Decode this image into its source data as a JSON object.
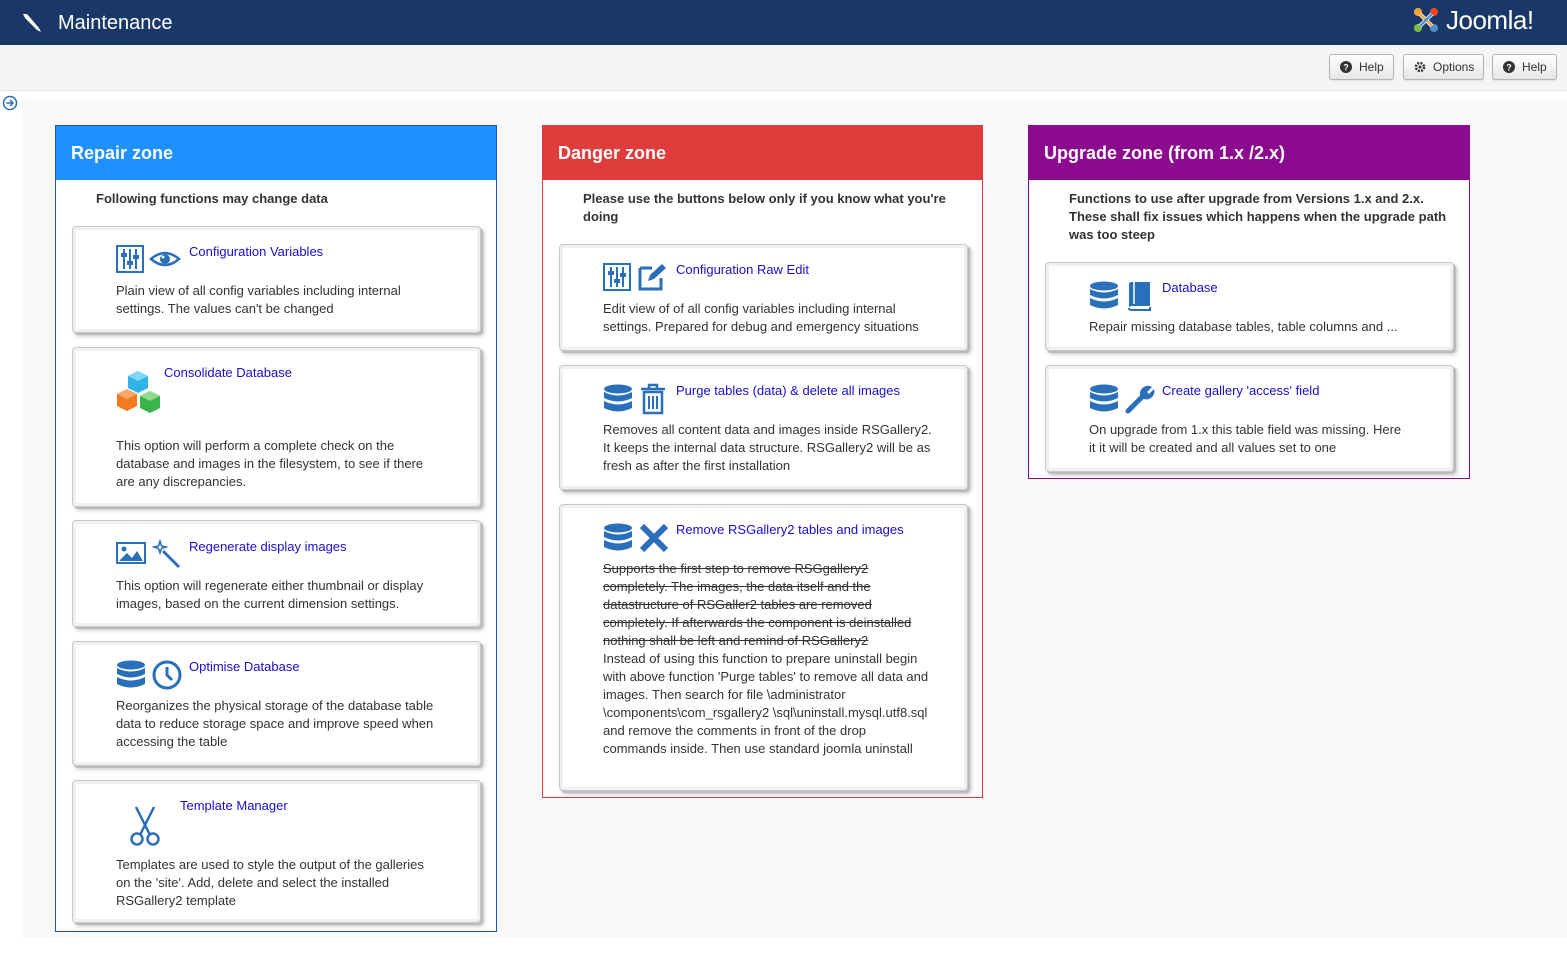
{
  "header": {
    "title": "Maintenance",
    "logo_text": "Joomla!"
  },
  "toolbar": {
    "help1_label": "Help",
    "options_label": "Options",
    "help2_label": "Help"
  },
  "zones": {
    "repair": {
      "title": "Repair zone",
      "description": "Following functions may change data",
      "color": "#1e90ff",
      "cards": [
        {
          "title": "Configuration Variables",
          "icons": [
            "sliders-icon",
            "eye-icon"
          ],
          "text": "Plain view of all config variables including internal settings. The values can't be changed"
        },
        {
          "title": "Consolidate Database",
          "icons": [
            "cubes-icon"
          ],
          "text": "This option will perform a complete check on the database and images in the filesystem, to see if there are any discrepancies."
        },
        {
          "title": "Regenerate display images",
          "icons": [
            "image-icon",
            "magic-wand-icon"
          ],
          "text": "This option will regenerate either thumbnail or display images, based on the current dimension settings."
        },
        {
          "title": "Optimise Database",
          "icons": [
            "database-icon",
            "clock-icon"
          ],
          "text": "Reorganizes the physical storage of the database table data to reduce storage space and improve speed when accessing the table"
        },
        {
          "title": "Template Manager",
          "icons": [
            "scissors-icon"
          ],
          "text": "Templates are used to style the output of the galleries on the 'site'. Add, delete and select the installed RSGallery2 template"
        }
      ]
    },
    "danger": {
      "title": "Danger zone",
      "description": "Please use the buttons below only if you know what you're doing",
      "color": "#e03c3c",
      "cards": [
        {
          "title": "Configuration Raw Edit",
          "icons": [
            "sliders-icon",
            "edit-icon"
          ],
          "text": "Edit view of of all config variables including internal settings. Prepared for debug and emergency situations"
        },
        {
          "title": "Purge tables (data) & delete all images",
          "icons": [
            "database-icon",
            "trash-icon"
          ],
          "text": "Removes all content data and images inside RSGallery2. It keeps the internal data structure. RSGallery2 will be as fresh as after the first installation"
        },
        {
          "title": "Remove RSGallery2 tables and images",
          "icons": [
            "database-icon",
            "times-icon"
          ],
          "text_struck": "Supports the first step to remove RSGgallery2 completely. The images, the data itself and the datastructure of RSGaller2 tables are removed completely. If afterwards the component is deinstalled nothing shall be left and remind of RSGallery2",
          "text": "Instead of using this function to prepare uninstall begin with above function 'Purge tables' to remove all data and images. Then search for file \\administrator \\components\\com_rsgallery2 \\sql\\uninstall.mysql.utf8.sql and remove the comments in front of the drop commands inside. Then use standard joomla uninstall"
        }
      ]
    },
    "upgrade": {
      "title": "Upgrade zone (from 1.x /2.x)",
      "description": "Functions to use after upgrade from Versions 1.x and 2.x. These shall fix issues which happens when the upgrade path was too steep",
      "color": "#8b0a8e",
      "cards": [
        {
          "title": "Database",
          "icons": [
            "database-icon",
            "book-icon"
          ],
          "text": "Repair missing database tables, table columns and ..."
        },
        {
          "title": "Create gallery 'access' field",
          "icons": [
            "database-icon",
            "wrench-icon"
          ],
          "text": "On upgrade from 1.x this table field was missing. Here it it will be created and all values set to one"
        }
      ]
    }
  }
}
